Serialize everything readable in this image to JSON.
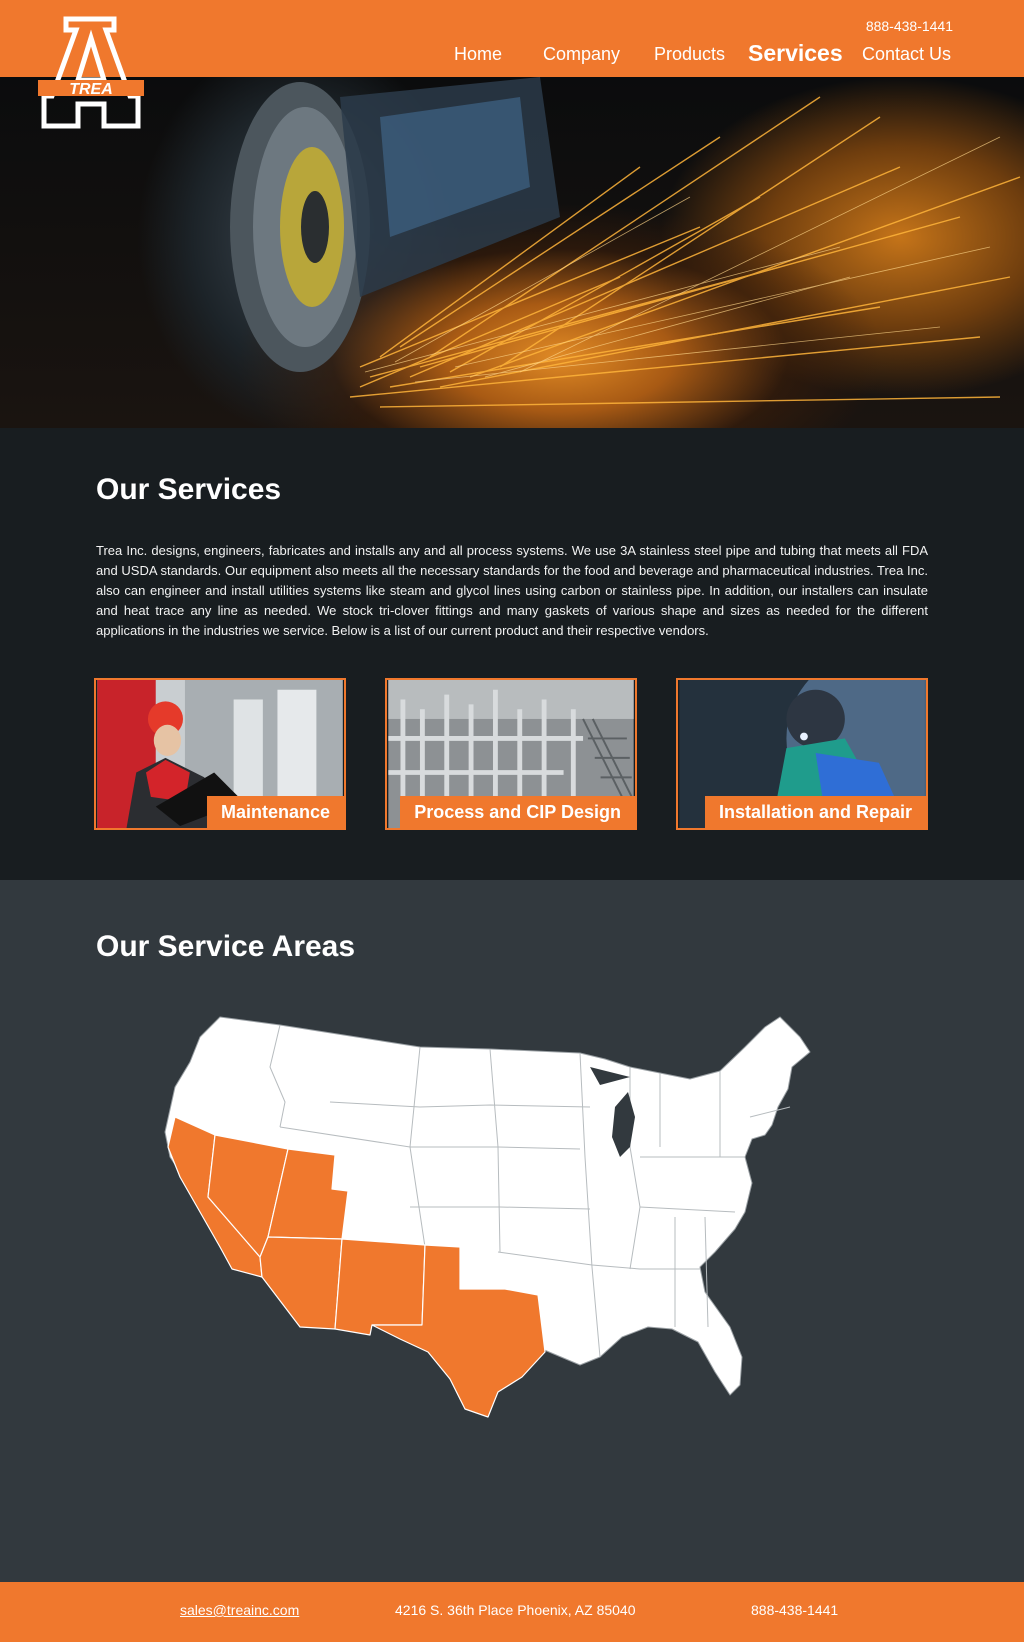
{
  "header": {
    "logo_text": "TREA",
    "phone": "888-438-1441",
    "nav": [
      {
        "label": "Home"
      },
      {
        "label": "Company"
      },
      {
        "label": "Products"
      },
      {
        "label": "Services",
        "active": true
      },
      {
        "label": "Contact Us"
      }
    ]
  },
  "services": {
    "title": "Our Services",
    "intro": "Trea Inc. designs, engineers, fabricates and installs any and all process systems. We use 3A stainless steel pipe and tubing that meets all FDA and USDA standards. Our equipment also meets all the necessary standards for the food and beverage and pharmaceutical industries. Trea Inc. also can engineer and install utilities systems like steam and glycol lines using carbon or stainless pipe. In addition, our installers can insulate and heat trace any line as needed. We stock tri-clover fittings and many gaskets of various shape and sizes as needed for the different applications in the industries we service. Below is a list of our current product and their respective vendors.",
    "cards": [
      {
        "label": "Maintenance"
      },
      {
        "label": "Process and CIP Design"
      },
      {
        "label": "Installation and Repair"
      }
    ]
  },
  "areas": {
    "title": "Our Service Areas",
    "highlight_color": "#f0782d",
    "highlighted_states": [
      "California",
      "Nevada",
      "Utah",
      "Arizona",
      "New Mexico",
      "Texas"
    ]
  },
  "footer": {
    "email": "sales@treainc.com",
    "address": "4216 S. 36th Place Phoenix, AZ 85040",
    "phone": "888-438-1441"
  },
  "colors": {
    "brand_orange": "#f0782d",
    "dark_section": "#181d20",
    "slate_section": "#32393e"
  }
}
